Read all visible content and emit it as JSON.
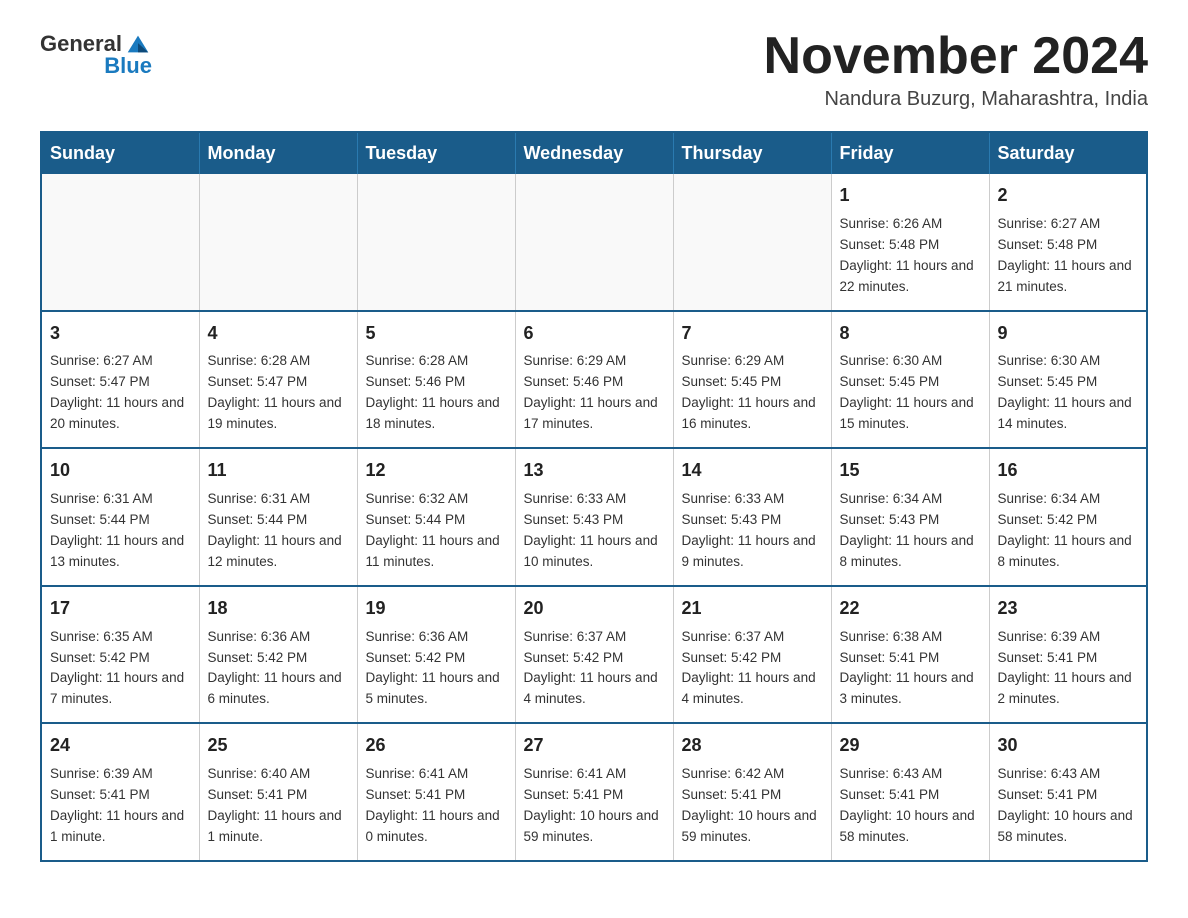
{
  "header": {
    "logo_general": "General",
    "logo_blue": "Blue",
    "month_title": "November 2024",
    "location": "Nandura Buzurg, Maharashtra, India"
  },
  "calendar": {
    "days_of_week": [
      "Sunday",
      "Monday",
      "Tuesday",
      "Wednesday",
      "Thursday",
      "Friday",
      "Saturday"
    ],
    "weeks": [
      [
        {
          "day": "",
          "info": ""
        },
        {
          "day": "",
          "info": ""
        },
        {
          "day": "",
          "info": ""
        },
        {
          "day": "",
          "info": ""
        },
        {
          "day": "",
          "info": ""
        },
        {
          "day": "1",
          "info": "Sunrise: 6:26 AM\nSunset: 5:48 PM\nDaylight: 11 hours and 22 minutes."
        },
        {
          "day": "2",
          "info": "Sunrise: 6:27 AM\nSunset: 5:48 PM\nDaylight: 11 hours and 21 minutes."
        }
      ],
      [
        {
          "day": "3",
          "info": "Sunrise: 6:27 AM\nSunset: 5:47 PM\nDaylight: 11 hours and 20 minutes."
        },
        {
          "day": "4",
          "info": "Sunrise: 6:28 AM\nSunset: 5:47 PM\nDaylight: 11 hours and 19 minutes."
        },
        {
          "day": "5",
          "info": "Sunrise: 6:28 AM\nSunset: 5:46 PM\nDaylight: 11 hours and 18 minutes."
        },
        {
          "day": "6",
          "info": "Sunrise: 6:29 AM\nSunset: 5:46 PM\nDaylight: 11 hours and 17 minutes."
        },
        {
          "day": "7",
          "info": "Sunrise: 6:29 AM\nSunset: 5:45 PM\nDaylight: 11 hours and 16 minutes."
        },
        {
          "day": "8",
          "info": "Sunrise: 6:30 AM\nSunset: 5:45 PM\nDaylight: 11 hours and 15 minutes."
        },
        {
          "day": "9",
          "info": "Sunrise: 6:30 AM\nSunset: 5:45 PM\nDaylight: 11 hours and 14 minutes."
        }
      ],
      [
        {
          "day": "10",
          "info": "Sunrise: 6:31 AM\nSunset: 5:44 PM\nDaylight: 11 hours and 13 minutes."
        },
        {
          "day": "11",
          "info": "Sunrise: 6:31 AM\nSunset: 5:44 PM\nDaylight: 11 hours and 12 minutes."
        },
        {
          "day": "12",
          "info": "Sunrise: 6:32 AM\nSunset: 5:44 PM\nDaylight: 11 hours and 11 minutes."
        },
        {
          "day": "13",
          "info": "Sunrise: 6:33 AM\nSunset: 5:43 PM\nDaylight: 11 hours and 10 minutes."
        },
        {
          "day": "14",
          "info": "Sunrise: 6:33 AM\nSunset: 5:43 PM\nDaylight: 11 hours and 9 minutes."
        },
        {
          "day": "15",
          "info": "Sunrise: 6:34 AM\nSunset: 5:43 PM\nDaylight: 11 hours and 8 minutes."
        },
        {
          "day": "16",
          "info": "Sunrise: 6:34 AM\nSunset: 5:42 PM\nDaylight: 11 hours and 8 minutes."
        }
      ],
      [
        {
          "day": "17",
          "info": "Sunrise: 6:35 AM\nSunset: 5:42 PM\nDaylight: 11 hours and 7 minutes."
        },
        {
          "day": "18",
          "info": "Sunrise: 6:36 AM\nSunset: 5:42 PM\nDaylight: 11 hours and 6 minutes."
        },
        {
          "day": "19",
          "info": "Sunrise: 6:36 AM\nSunset: 5:42 PM\nDaylight: 11 hours and 5 minutes."
        },
        {
          "day": "20",
          "info": "Sunrise: 6:37 AM\nSunset: 5:42 PM\nDaylight: 11 hours and 4 minutes."
        },
        {
          "day": "21",
          "info": "Sunrise: 6:37 AM\nSunset: 5:42 PM\nDaylight: 11 hours and 4 minutes."
        },
        {
          "day": "22",
          "info": "Sunrise: 6:38 AM\nSunset: 5:41 PM\nDaylight: 11 hours and 3 minutes."
        },
        {
          "day": "23",
          "info": "Sunrise: 6:39 AM\nSunset: 5:41 PM\nDaylight: 11 hours and 2 minutes."
        }
      ],
      [
        {
          "day": "24",
          "info": "Sunrise: 6:39 AM\nSunset: 5:41 PM\nDaylight: 11 hours and 1 minute."
        },
        {
          "day": "25",
          "info": "Sunrise: 6:40 AM\nSunset: 5:41 PM\nDaylight: 11 hours and 1 minute."
        },
        {
          "day": "26",
          "info": "Sunrise: 6:41 AM\nSunset: 5:41 PM\nDaylight: 11 hours and 0 minutes."
        },
        {
          "day": "27",
          "info": "Sunrise: 6:41 AM\nSunset: 5:41 PM\nDaylight: 10 hours and 59 minutes."
        },
        {
          "day": "28",
          "info": "Sunrise: 6:42 AM\nSunset: 5:41 PM\nDaylight: 10 hours and 59 minutes."
        },
        {
          "day": "29",
          "info": "Sunrise: 6:43 AM\nSunset: 5:41 PM\nDaylight: 10 hours and 58 minutes."
        },
        {
          "day": "30",
          "info": "Sunrise: 6:43 AM\nSunset: 5:41 PM\nDaylight: 10 hours and 58 minutes."
        }
      ]
    ]
  }
}
